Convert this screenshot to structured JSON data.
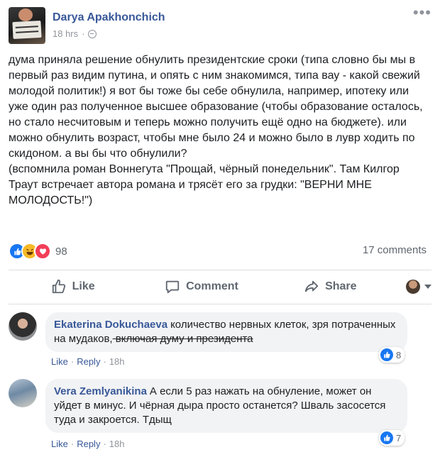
{
  "post": {
    "author": "Darya Apakhonchich",
    "time": "18 hrs",
    "dot": "·",
    "text": "дума приняла решение обнулить президентские сроки (типа словно бы мы в первый раз видим путина, и опять с ним знакомимся, типа вау - какой свежий молодой политик!) я вот бы тоже бы себе обнулила, например, ипотеку или уже один раз полученное высшее образование (чтобы образование осталось, но стало несчитовым и теперь можно получить ещё одно на бюджете). или можно обнулить возраст, чтобы мне было 24 и можно было в лувр ходить по скидоном. а вы бы что обнулили?\n(вспомнила роман Воннегута \"Прощай, чёрный понедельник\". Там Килгор Траут встречает автора романа и трясёт его за грудки: \"ВЕРНИ МНЕ МОЛОДОСТЬ!\")",
    "reaction_count": "98",
    "comments_count": "17 comments"
  },
  "actions": {
    "like": "Like",
    "comment": "Comment",
    "share": "Share"
  },
  "comments": [
    {
      "name": "Ekaterina Dokuchaeva",
      "text": "количество нервных клеток, зря потраченных на мудаков,",
      "strike_text": " включая думу и президента",
      "reaction_count": "8",
      "like": "Like",
      "reply": "Reply",
      "time": "18h"
    },
    {
      "name": "Vera Zemlyanikina",
      "text": "А если 5 раз нажать на обнуление, может он уйдет в минус. И чёрная дыра просто останется? Шваль засосется туда и закроется. Тдыщ",
      "reaction_count": "7",
      "like": "Like",
      "reply": "Reply",
      "time": "18h"
    }
  ],
  "icons": [
    "globe-icon",
    "like-icon",
    "haha-icon",
    "love-icon",
    "comment-icon",
    "share-icon",
    "more-icon"
  ],
  "colors": {
    "link": "#385898",
    "like_blue": "#1877f2",
    "muted": "#606770"
  }
}
